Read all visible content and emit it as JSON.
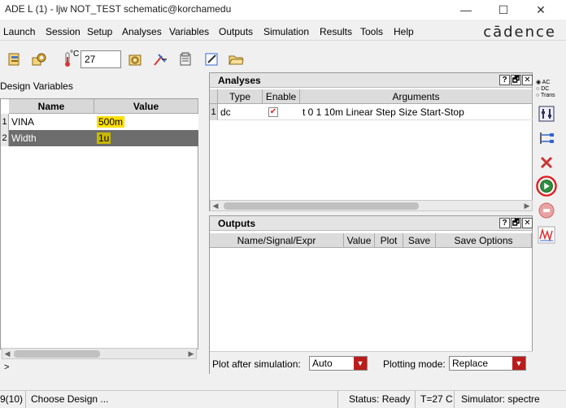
{
  "window": {
    "title": "ADE L (1) - ljw NOT_TEST schematic@korchamedu",
    "minimize": "—",
    "maximize": "☐",
    "close": "✕"
  },
  "menu": {
    "items": [
      "Launch",
      "Session",
      "Setup",
      "Analyses",
      "Variables",
      "Outputs",
      "Simulation",
      "Results",
      "Tools",
      "Help"
    ],
    "brand": "cādence"
  },
  "toolbar": {
    "temperature_unit": "°C",
    "temperature_value": "27"
  },
  "design_variables": {
    "title": "Design Variables",
    "headers": [
      "Name",
      "Value"
    ],
    "rows": [
      {
        "num": "1",
        "name": "VINA",
        "value": "500m"
      },
      {
        "num": "2",
        "name": "Width",
        "value": "1u"
      }
    ]
  },
  "analyses": {
    "title": "Analyses",
    "headers": [
      "Type",
      "Enable",
      "Arguments"
    ],
    "rows": [
      {
        "num": "1",
        "type": "dc",
        "enabled": "✔",
        "arguments": "t 0 1 10m Linear Step Size Start-Stop"
      }
    ],
    "buttons": [
      "?",
      "🗗",
      "✕"
    ]
  },
  "outputs": {
    "title": "Outputs",
    "headers": [
      "Name/Signal/Expr",
      "Value",
      "Plot",
      "Save",
      "Save Options"
    ],
    "buttons": [
      "?",
      "🗗",
      "✕"
    ],
    "plot_after_label": "Plot after simulation:",
    "plot_after_value": "Auto",
    "plotting_mode_label": "Plotting mode:",
    "plotting_mode_value": "Replace"
  },
  "sidebar": {
    "radio_labels": [
      "AC",
      "DC",
      "Trans"
    ]
  },
  "command_prompt": ">",
  "status": {
    "mouse": "9(10)",
    "message": "Choose Design ...",
    "state": "Status: Ready",
    "temperature": "T=27 C",
    "simulator": "Simulator: spectre"
  },
  "colors": {
    "highlight": "#ffe000",
    "run_ring": "#e01b1b",
    "combo_red": "#b91c1c"
  }
}
